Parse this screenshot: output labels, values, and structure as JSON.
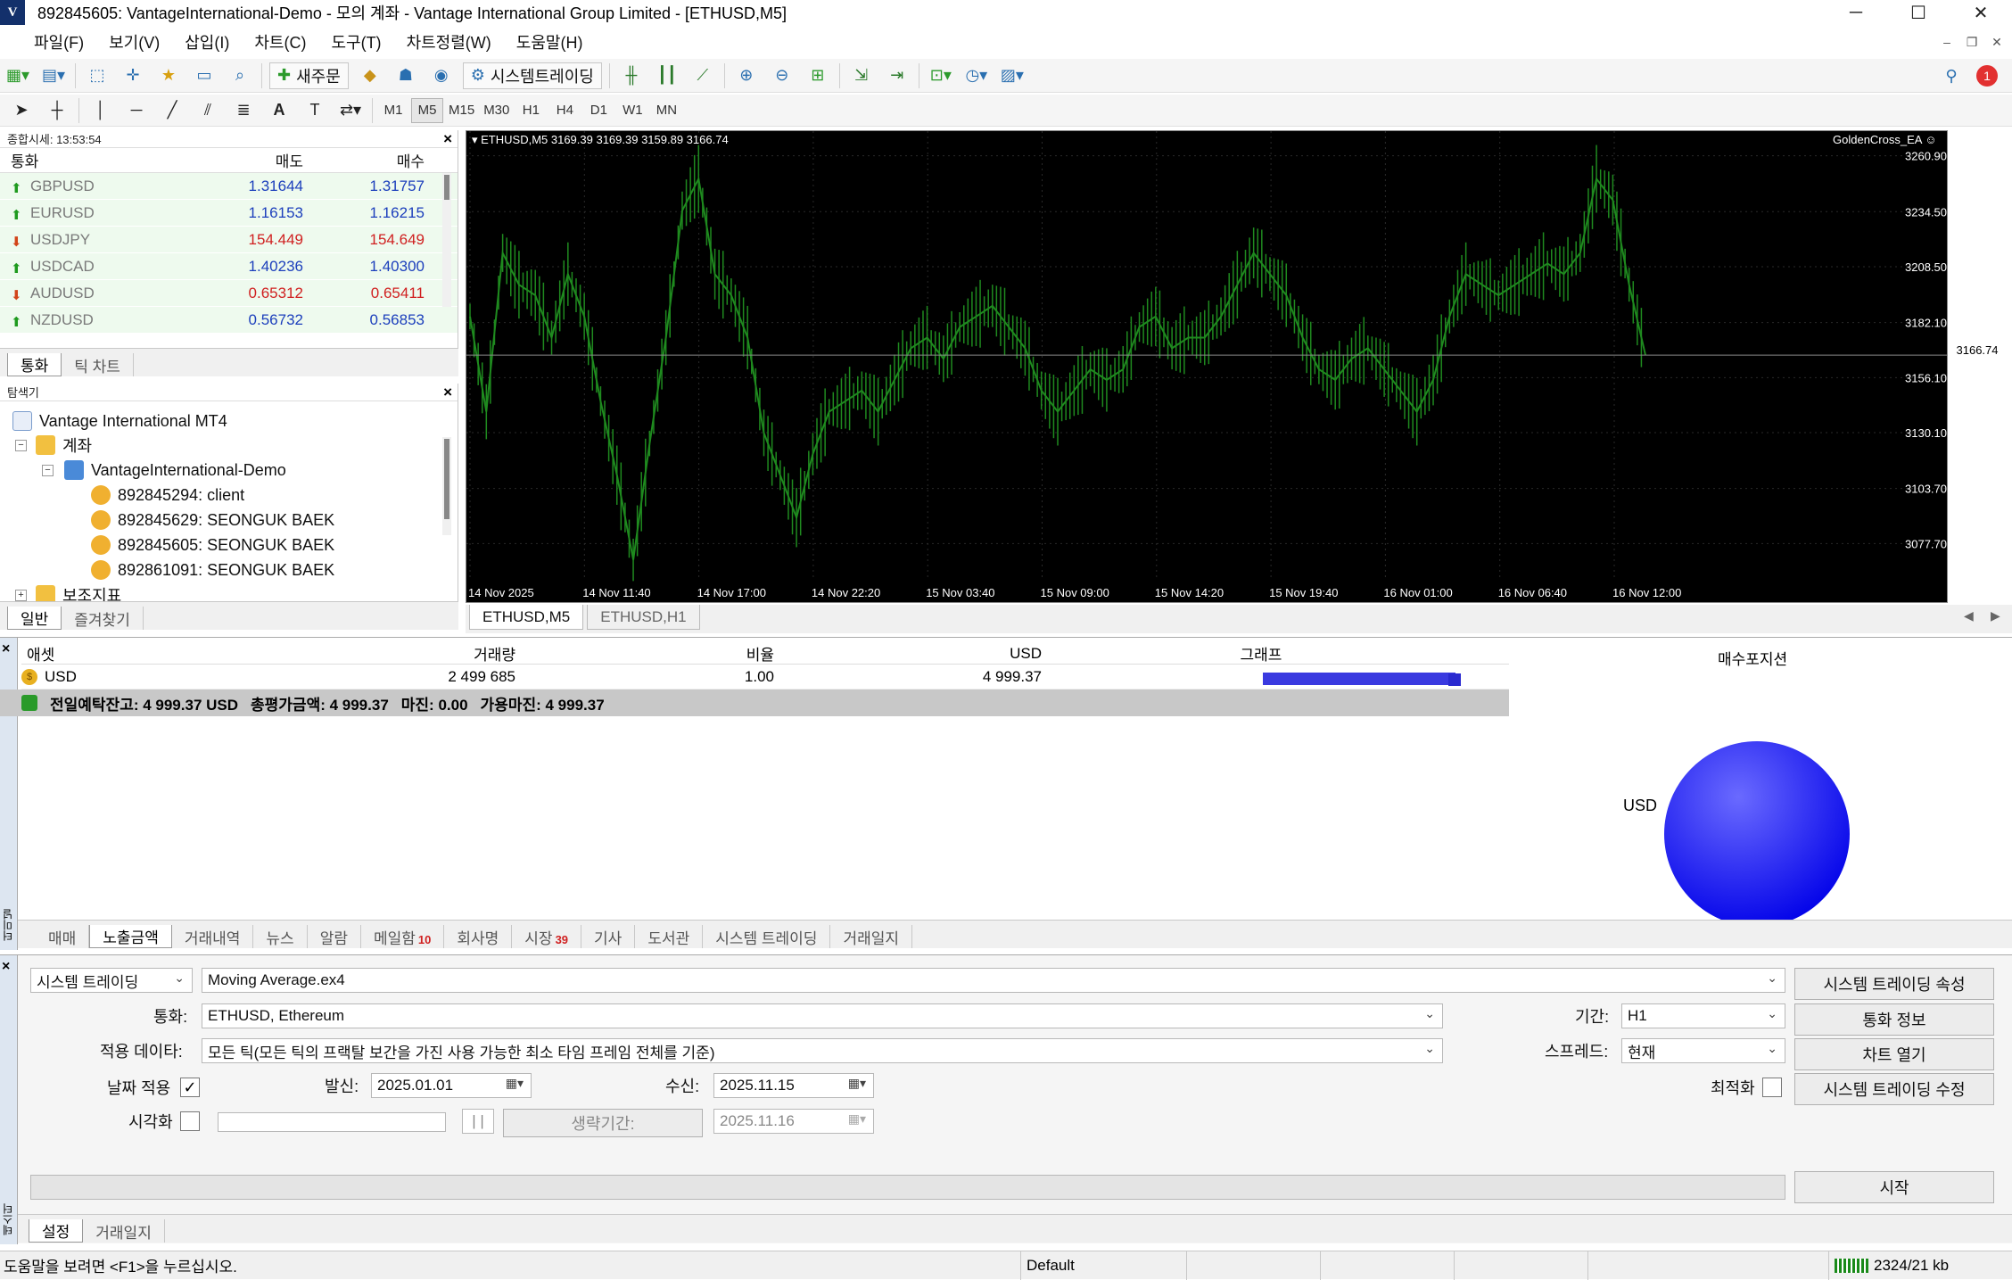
{
  "window": {
    "title": "892845605: VantageInternational-Demo - 모의 계좌 - Vantage International Group Limited - [ETHUSD,M5]",
    "app_icon": "V"
  },
  "menu": [
    "파일(F)",
    "보기(V)",
    "삽입(I)",
    "차트(C)",
    "도구(T)",
    "차트정렬(W)",
    "도움말(H)"
  ],
  "toolbar": {
    "new_order_label": "새주문",
    "auto_trading_label": "시스템트레이딩",
    "notification_count": "1"
  },
  "timeframes": [
    "M1",
    "M5",
    "M15",
    "M30",
    "H1",
    "H4",
    "D1",
    "W1",
    "MN"
  ],
  "active_timeframe": "M5",
  "market_watch": {
    "title": "종합시세: 13:53:54",
    "headers": {
      "symbol": "통화",
      "bid": "매도",
      "ask": "매수"
    },
    "rows": [
      {
        "symbol": "GBPUSD",
        "bid": "1.31644",
        "ask": "1.31757",
        "dir": "up"
      },
      {
        "symbol": "EURUSD",
        "bid": "1.16153",
        "ask": "1.16215",
        "dir": "up"
      },
      {
        "symbol": "USDJPY",
        "bid": "154.449",
        "ask": "154.649",
        "dir": "down"
      },
      {
        "symbol": "USDCAD",
        "bid": "1.40236",
        "ask": "1.40300",
        "dir": "up"
      },
      {
        "symbol": "AUDUSD",
        "bid": "0.65312",
        "ask": "0.65411",
        "dir": "down"
      },
      {
        "symbol": "NZDUSD",
        "bid": "0.56732",
        "ask": "0.56853",
        "dir": "up"
      }
    ],
    "tabs": [
      "통화",
      "틱 차트"
    ]
  },
  "navigator": {
    "title": "탐색기",
    "root": "Vantage International MT4",
    "accounts_label": "계좌",
    "server": "VantageInternational-Demo",
    "accounts": [
      "892845294: client",
      "892845629: SEONGUK BAEK",
      "892845605: SEONGUK BAEK",
      "892861091: SEONGUK BAEK"
    ],
    "indicators_label": "보조지표",
    "tabs": [
      "일반",
      "즐겨찾기"
    ]
  },
  "chart": {
    "symbol_info": "ETHUSD,M5  3169.39 3169.39 3159.89 3166.74",
    "ea_name": "GoldenCross_EA",
    "current_price": "3166.74",
    "price_labels": [
      "3260.90",
      "3234.50",
      "3208.50",
      "3182.10",
      "3156.10",
      "3130.10",
      "3103.70",
      "3077.70"
    ],
    "time_labels": [
      "14 Nov 2025",
      "14 Nov 11:40",
      "14 Nov 17:00",
      "14 Nov 22:20",
      "15 Nov 03:40",
      "15 Nov 09:00",
      "15 Nov 14:20",
      "15 Nov 19:40",
      "16 Nov 01:00",
      "16 Nov 06:40",
      "16 Nov 12:00"
    ],
    "tabs": [
      "ETHUSD,M5",
      "ETHUSD,H1"
    ],
    "candle_color": "#1f8a1f"
  },
  "chart_data": {
    "type": "line",
    "title": "",
    "xlabel": "",
    "ylabel": "",
    "ylim": [
      3061.0,
      3267.5
    ],
    "x_ticks": [
      "14 Nov 2025",
      "14 Nov 11:40",
      "14 Nov 17:00",
      "14 Nov 22:20",
      "15 Nov 03:40",
      "15 Nov 09:00",
      "15 Nov 14:20",
      "15 Nov 19:40",
      "16 Nov 01:00",
      "16 Nov 06:40",
      "16 Nov 12:00"
    ],
    "series": [
      {
        "values": [
          3185,
          3140,
          3215,
          3200,
          3195,
          3175,
          3205,
          3185,
          3145,
          3110,
          3070,
          3125,
          3175,
          3235,
          3250,
          3205,
          3195,
          3175,
          3130,
          3110,
          3090,
          3120,
          3140,
          3145,
          3150,
          3140,
          3155,
          3170,
          3175,
          3165,
          3180,
          3185,
          3190,
          3180,
          3170,
          3150,
          3140,
          3150,
          3160,
          3155,
          3160,
          3180,
          3185,
          3170,
          3175,
          3175,
          3185,
          3200,
          3215,
          3205,
          3195,
          3175,
          3160,
          3155,
          3165,
          3170,
          3160,
          3150,
          3140,
          3155,
          3185,
          3205,
          3200,
          3195,
          3200,
          3205,
          3210,
          3205,
          3215,
          3250,
          3240,
          3200,
          3166.74
        ]
      }
    ]
  },
  "exposure": {
    "headers": [
      "애셋",
      "거래량",
      "비율",
      "USD",
      "그래프",
      "매수포지션"
    ],
    "row": {
      "asset": "USD",
      "volume": "2 499 685",
      "ratio": "1.00",
      "usd": "4 999.37"
    },
    "summary": {
      "balance": "전일예탁잔고: 4 999.37 USD",
      "equity": "총평가금액: 4 999.37",
      "margin": "마진: 0.00",
      "free_margin": "가용마진: 4 999.37"
    },
    "pie_label": "USD",
    "pie_fraction": 1.0,
    "bar_color": "#3a3ae0"
  },
  "terminal_tabs": [
    {
      "label": "매매"
    },
    {
      "label": "노출금액"
    },
    {
      "label": "거래내역"
    },
    {
      "label": "뉴스"
    },
    {
      "label": "알람"
    },
    {
      "label": "메일함",
      "badge": "10"
    },
    {
      "label": "회사명"
    },
    {
      "label": "시장",
      "badge": "39"
    },
    {
      "label": "기사"
    },
    {
      "label": "도서관"
    },
    {
      "label": "시스템 트레이딩"
    },
    {
      "label": "거래일지"
    }
  ],
  "terminal_active_tab": "노출금액",
  "terminal_side_label": "터미널",
  "tester": {
    "type_value": "시스템 트레이딩",
    "expert_value": "Moving Average.ex4",
    "symbol_label": "통화:",
    "symbol_value": "ETHUSD, Ethereum",
    "model_label": "적용 데이타:",
    "model_value": "모든 틱(모든 틱의 프랙탈 보간을 가진 사용 가능한 최소 타임 프레임 전체를 기준)",
    "use_date_label": "날짜 적용",
    "from_label": "발신:",
    "from_value": "2025.01.01",
    "to_label": "수신:",
    "to_value": "2025.11.15",
    "visual_label": "시각화",
    "skip_to_label": "생략기간:",
    "skip_to_value": "2025.11.16",
    "period_label": "기간:",
    "period_value": "H1",
    "spread_label": "스프레드:",
    "spread_value": "현재",
    "optimization_label": "최적화",
    "btn_expert_props": "시스템 트레이딩 속성",
    "btn_symbol_props": "통화 정보",
    "btn_open_chart": "차트 열기",
    "btn_modify_expert": "시스템 트레이딩 수정",
    "btn_start": "시작",
    "pause_btn": "| |",
    "tabs": [
      "설정",
      "거래일지"
    ],
    "side_label": "테스터"
  },
  "status": {
    "help": "도움말을 보려면 <F1>을 누르십시오.",
    "profile": "Default",
    "traffic": "2324/21 kb"
  }
}
